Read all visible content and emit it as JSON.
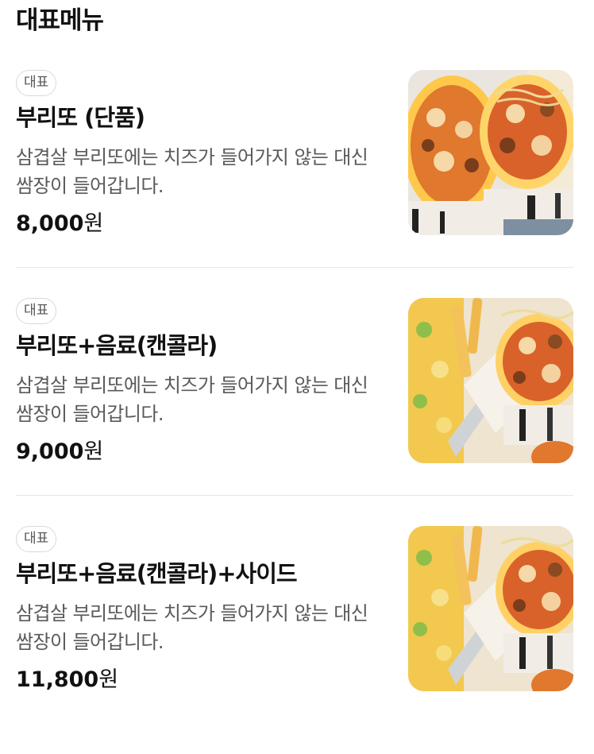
{
  "section_title": "대표메뉴",
  "items": [
    {
      "badge": "대표",
      "name": "부리또 (단품)",
      "description": "삼겹살 부리또에는 치즈가 들어가지 않는 대신 쌈장이 들어갑니다.",
      "price": "8,000",
      "currency": "원",
      "image_icon": "burrito-photo"
    },
    {
      "badge": "대표",
      "name": "부리또+음료(캔콜라)",
      "description": "삼겹살 부리또에는 치즈가 들어가지 않는 대신 쌈장이 들어갑니다.",
      "price": "9,000",
      "currency": "원",
      "image_icon": "burrito-set-photo"
    },
    {
      "badge": "대표",
      "name": "부리또+음료(캔콜라)+사이드",
      "description": "삼겹살 부리또에는 치즈가 들어가지 않는 대신 쌈장이 들어갑니다.",
      "price": "11,800",
      "currency": "원",
      "image_icon": "burrito-set-photo"
    }
  ]
}
